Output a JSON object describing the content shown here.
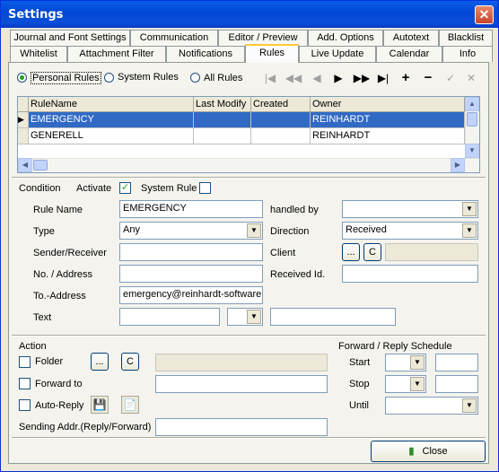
{
  "window": {
    "title": "Settings"
  },
  "tabs_row1": [
    "Journal and Font Settings",
    "Communication",
    "Editor / Preview",
    "Add. Options",
    "Autotext",
    "Blacklist"
  ],
  "tabs_row2": [
    "Whitelist",
    "Attachment Filter",
    "Notifications",
    "Rules",
    "Live Update",
    "Calendar",
    "Info"
  ],
  "active_tab": "Rules",
  "rule_scope": {
    "options": [
      "Personal Rules",
      "System Rules",
      "All Rules"
    ],
    "selected": "Personal Rules"
  },
  "toolbar": {
    "icons": [
      "first-record-icon",
      "prior-page-icon",
      "prior-record-icon",
      "next-record-icon",
      "next-page-icon",
      "last-record-icon",
      "add-record-icon",
      "delete-record-icon",
      "post-edit-icon",
      "cancel-edit-icon"
    ]
  },
  "rules_table": {
    "columns": [
      "RuleName",
      "Last Modify",
      "Created",
      "Owner"
    ],
    "rows": [
      {
        "name": "EMERGENCY",
        "last_modify": "",
        "created": "",
        "owner": "REINHARDT",
        "selected": true
      },
      {
        "name": "GENERELL",
        "last_modify": "",
        "created": "",
        "owner": "REINHARDT",
        "selected": false
      }
    ]
  },
  "condition": {
    "heading": "Condition",
    "activate_label": "Activate",
    "activate_checked": true,
    "system_rule_label": "System Rule",
    "system_rule_checked": false,
    "rule_name_label": "Rule Name",
    "rule_name_value": "EMERGENCY",
    "type_label": "Type",
    "type_value": "Any",
    "sender_label": "Sender/Receiver",
    "sender_value": "",
    "no_address_label": "No. / Address",
    "no_address_value": "",
    "to_address_label": "To.-Address",
    "to_address_value": "emergency@reinhardt-software.",
    "text_label": "Text",
    "text_value": "",
    "handled_by_label": "handled by",
    "handled_by_value": "",
    "direction_label": "Direction",
    "direction_value": "Received",
    "client_label": "Client",
    "client_browse": "...",
    "client_clear": "C",
    "received_id_label": "Received Id.",
    "received_id_value": ""
  },
  "action": {
    "heading": "Action",
    "folder_label": "Folder",
    "folder_browse": "...",
    "folder_clear": "C",
    "forward_label": "Forward to",
    "autoreply_label": "Auto-Reply",
    "sending_addr_label": "Sending Addr.(Reply/Forward)",
    "sending_addr_value": ""
  },
  "schedule": {
    "heading": "Forward / Reply Schedule",
    "start_label": "Start",
    "stop_label": "Stop",
    "until_label": "Until"
  },
  "close_button": "Close"
}
